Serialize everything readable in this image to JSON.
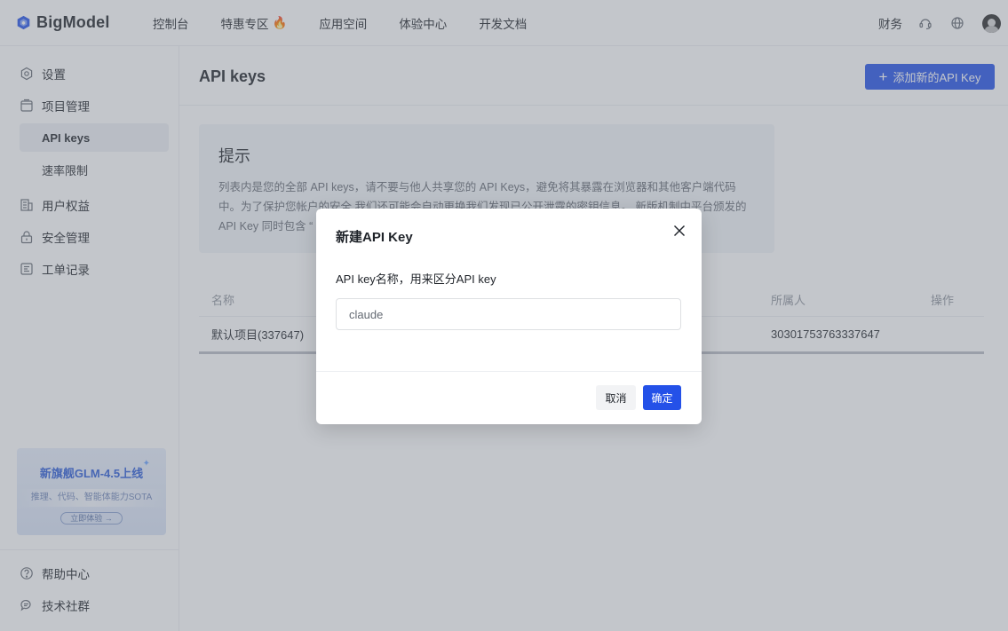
{
  "brand": {
    "name": "BigModel",
    "accent": "#2451e8"
  },
  "topnav": {
    "items": [
      {
        "label": "控制台"
      },
      {
        "label": "特惠专区",
        "icon": "fire-icon",
        "glyph": "🔥"
      },
      {
        "label": "应用空间"
      },
      {
        "label": "体验中心"
      },
      {
        "label": "开发文档"
      }
    ],
    "finance": "财务",
    "icons": [
      "support-icon",
      "globe-icon",
      "avatar"
    ]
  },
  "sidebar": {
    "items": [
      {
        "label": "设置",
        "icon": "settings-icon"
      },
      {
        "label": "项目管理",
        "icon": "project-icon"
      },
      {
        "label": "API keys",
        "active": true
      },
      {
        "label": "速率限制"
      },
      {
        "label": "用户权益",
        "icon": "benefits-icon"
      },
      {
        "label": "安全管理",
        "icon": "lock-icon"
      },
      {
        "label": "工单记录",
        "icon": "ticket-icon"
      }
    ],
    "promo": {
      "title": "新旗舰GLM-4.5上线",
      "subtitle": "推理、代码、智能体能力SOTA",
      "cta": "立即体验 →"
    },
    "bottom": [
      {
        "label": "帮助中心",
        "icon": "help-icon"
      },
      {
        "label": "技术社群",
        "icon": "community-icon"
      }
    ]
  },
  "main": {
    "title": "API keys",
    "add_button": "添加新的API Key",
    "tip": {
      "title": "提示",
      "text": "列表内是您的全部 API keys，请不要与他人共享您的 API Keys，避免将其暴露在浏览器和其他客户端代码中。为了保护您帐户的安全,我们还可能会自动更换我们发现已公开泄露的密钥信息。 新版机制中平台颁发的 API Key 同时包含 “"
    },
    "table": {
      "columns": [
        "名称",
        "所属人",
        "操作"
      ],
      "rows": [
        {
          "name": "默认项目(337647)",
          "owner": "30301753763337647"
        }
      ]
    }
  },
  "modal": {
    "title": "新建API Key",
    "field_label": "API key名称，用来区分API key",
    "input_value": "claude",
    "cancel": "取消",
    "confirm": "确定"
  }
}
